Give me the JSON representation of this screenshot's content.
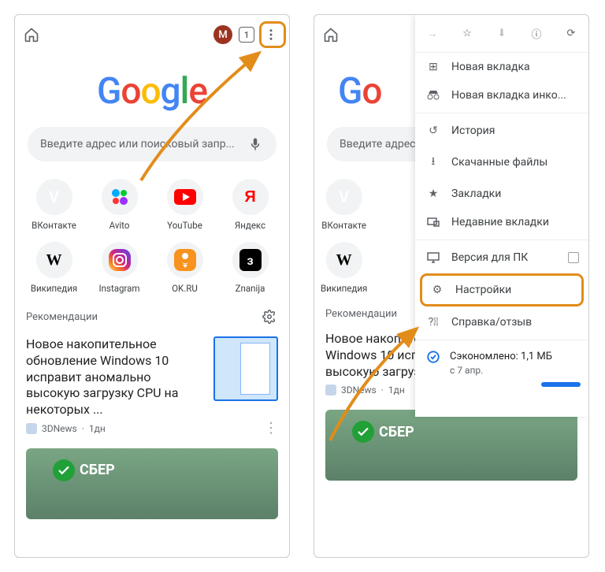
{
  "topbar": {
    "avatar_letter": "M",
    "tab_count": "1"
  },
  "logo": {
    "g": "G",
    "o1": "o",
    "o2": "o",
    "g2": "g",
    "l": "l",
    "e": "e"
  },
  "search": {
    "placeholder": "Введите адрес или поисковый запр..."
  },
  "shortcuts": [
    {
      "label": "ВКонтакте",
      "glyph": "V",
      "cls": "ic-vk"
    },
    {
      "label": "Avito",
      "glyph": "",
      "cls": "ic-av"
    },
    {
      "label": "YouTube",
      "glyph": "▶",
      "cls": "ic-yt"
    },
    {
      "label": "Яндекс",
      "glyph": "Я",
      "cls": "ic-ya"
    },
    {
      "label": "Википедия",
      "glyph": "W",
      "cls": "ic-w"
    },
    {
      "label": "Instagram",
      "glyph": "",
      "cls": "ic-ig"
    },
    {
      "label": "OK.RU",
      "glyph": "OK",
      "cls": "ic-ok"
    },
    {
      "label": "Znanija",
      "glyph": "з",
      "cls": "ic-zn"
    }
  ],
  "recs": {
    "header": "Рекомендации"
  },
  "card": {
    "title": "Новое накопительное обновление Windows 10 исправит аномально высокую загрузку CPU на некоторых ...",
    "source": "3DNews",
    "age": "1дн"
  },
  "sber": {
    "text": "СБЕР"
  },
  "menu_top_icons": [
    "→",
    "☆",
    "⬇",
    "ⓘ",
    "⟳"
  ],
  "menu": {
    "new_tab": "Новая вкладка",
    "incognito": "Новая вкладка инко...",
    "history": "История",
    "downloads": "Скачанные файлы",
    "bookmarks": "Закладки",
    "recent": "Недавние вкладки",
    "desktop": "Версия для ПК",
    "settings": "Настройки",
    "help": "Справка/отзыв",
    "saved_label": "Сэкономлено:",
    "saved_value": "1,1 МБ",
    "saved_since": "с 7 апр."
  }
}
